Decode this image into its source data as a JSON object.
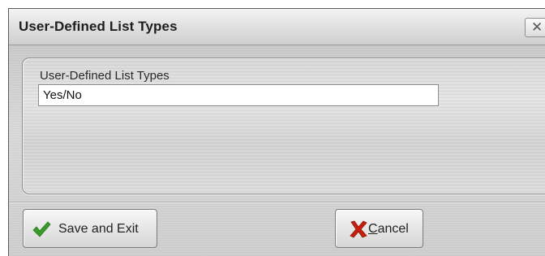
{
  "window": {
    "title": "User-Defined List Types",
    "close_symbol": "✕"
  },
  "group": {
    "label": "User-Defined List Types",
    "value": "Yes/No"
  },
  "buttons": {
    "save": {
      "label": "Save and Exit",
      "icon": "checkmark-icon",
      "icon_color": "#3a9a2a"
    },
    "cancel": {
      "mnemonic": "C",
      "label_rest": "ancel",
      "icon": "x-icon",
      "icon_color": "#c81e0e"
    }
  }
}
